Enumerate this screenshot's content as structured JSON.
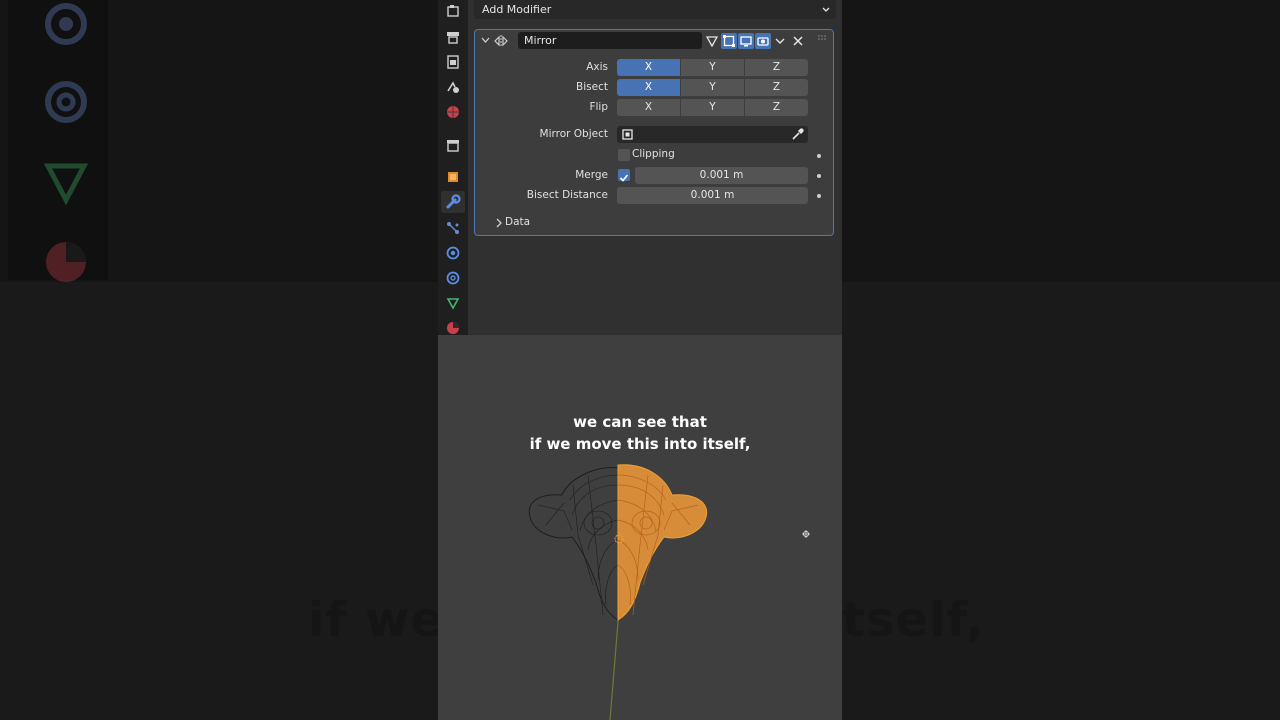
{
  "add_modifier": {
    "label": "Add Modifier"
  },
  "modifier": {
    "name": "Mirror",
    "axis": {
      "label": "Axis",
      "options": [
        "X",
        "Y",
        "Z"
      ],
      "active": [
        "X"
      ]
    },
    "bisect": {
      "label": "Bisect",
      "options": [
        "X",
        "Y",
        "Z"
      ],
      "active": [
        "X"
      ]
    },
    "flip": {
      "label": "Flip",
      "options": [
        "X",
        "Y",
        "Z"
      ],
      "active": []
    },
    "mirror_object": {
      "label": "Mirror Object",
      "value": ""
    },
    "clipping": {
      "label": "Clipping",
      "checked": false
    },
    "merge": {
      "label": "Merge",
      "checked": true,
      "value": "0.001 m"
    },
    "bisect_distance": {
      "label": "Bisect Distance",
      "value": "0.001 m"
    },
    "data_section": {
      "label": "Data",
      "expanded": false
    }
  },
  "subtitle": {
    "line1": "we can see that",
    "line2": "if we move this into itself,"
  },
  "background_caption": {
    "left": "if we",
    "right": "tself,"
  },
  "colors": {
    "accent": "#4772b3",
    "selection": "#f5a030",
    "wire": "#1e1e1e",
    "panel": "#3d3d3d"
  },
  "icons": {
    "tabs": [
      "tool-icon",
      "render-icon",
      "output-icon",
      "view-layer-icon",
      "scene-icon",
      "world-icon",
      "collection-icon",
      "object-icon",
      "modifier-icon",
      "particles-icon",
      "physics-icon",
      "constraints-icon",
      "object-data-icon",
      "material-icon"
    ]
  }
}
